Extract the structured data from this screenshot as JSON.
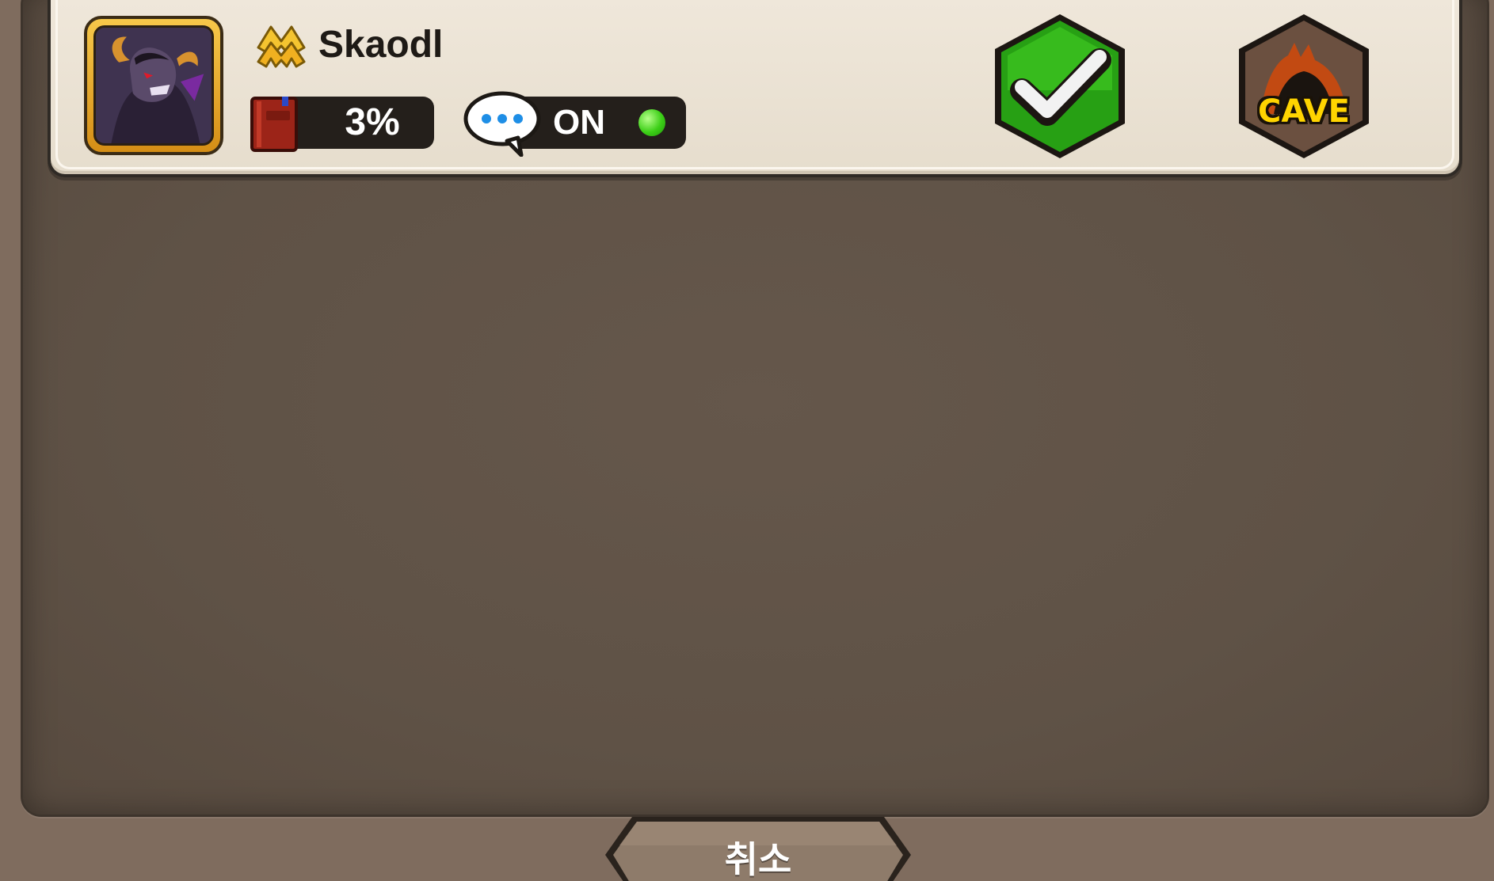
{
  "player": {
    "name": "Skaodl",
    "progress": "3%",
    "chat_status": "ON",
    "rank_icon": "double-chevron-rank-icon",
    "avatar": "dragon-portrait"
  },
  "actions": {
    "confirm_icon": "checkmark-icon",
    "cave_label": "CAVE"
  },
  "footer": {
    "cancel_label": "취소"
  },
  "colors": {
    "panel": "#5f5246",
    "card": "#e9e0d1",
    "confirm_green": "#2fa61a",
    "status_green": "#3ccf17",
    "gold": "#f2b632",
    "cave_text": "#ffd400"
  }
}
